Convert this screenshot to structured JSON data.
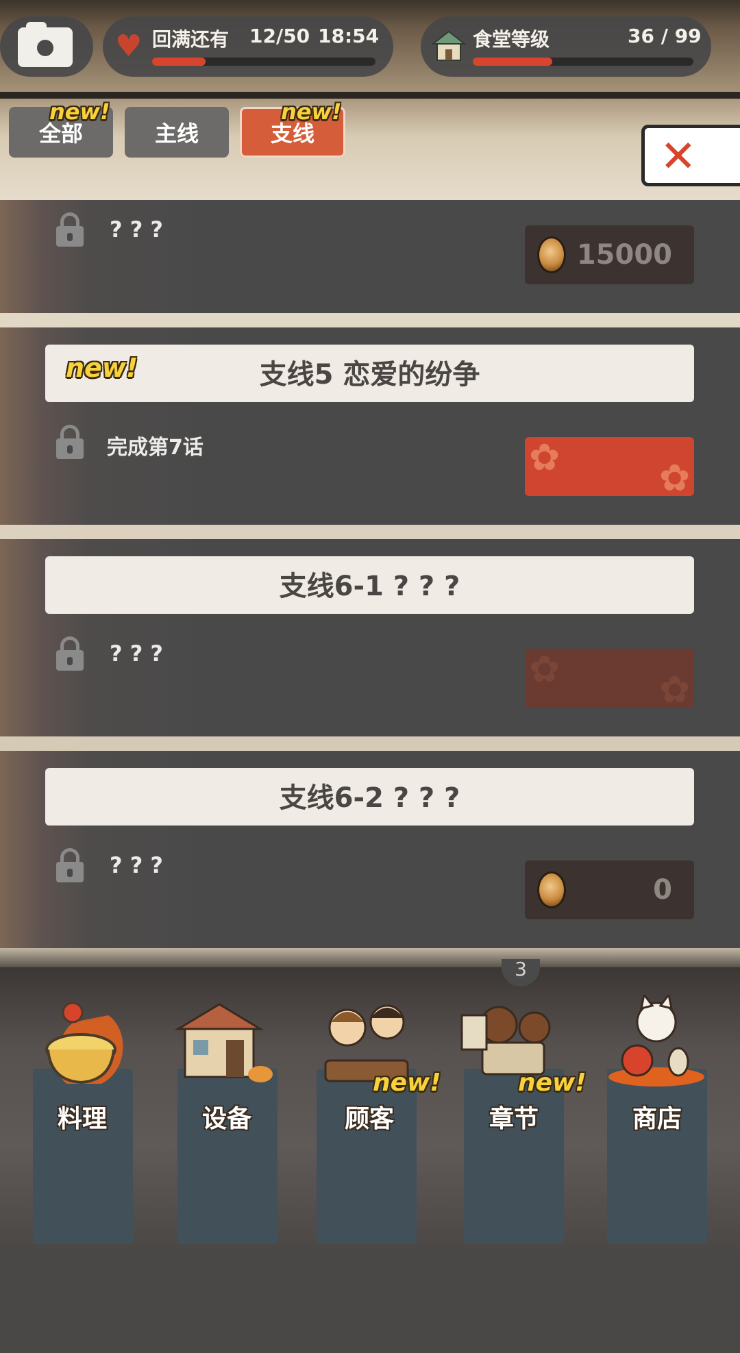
{
  "status": {
    "life_label": "回满还有",
    "life_value": "12/50",
    "life_timer": "18:54",
    "life_fill": 0.24,
    "level_label": "食堂等级",
    "level_value": "36 / 99",
    "level_fill": 0.36
  },
  "tabs": [
    {
      "label": "全部",
      "new": "new!",
      "active": false
    },
    {
      "label": "主线",
      "new": "",
      "active": false
    },
    {
      "label": "支线",
      "new": "new!",
      "active": true
    }
  ],
  "close_symbol": "✕",
  "entries": [
    {
      "title": "",
      "new": "",
      "requirement": "? ? ?",
      "cost": "15000",
      "status": "cost"
    },
    {
      "title": "支线5    恋爱的纷争",
      "new": "new!",
      "requirement": "完成第7话",
      "cost": "",
      "status": "unlock-button"
    },
    {
      "title": "支线6-1 ? ? ?",
      "new": "",
      "requirement": "? ? ?",
      "cost": "",
      "status": "unlock-button-disabled"
    },
    {
      "title": "支线6-2 ? ? ?",
      "new": "",
      "requirement": "? ? ?",
      "cost": "0",
      "status": "cost"
    }
  ],
  "nav_badge": "3",
  "nav": [
    {
      "label": "料理",
      "new": ""
    },
    {
      "label": "设备",
      "new": ""
    },
    {
      "label": "顾客",
      "new": "new!"
    },
    {
      "label": "章节",
      "new": "new!"
    },
    {
      "label": "商店",
      "new": ""
    }
  ]
}
